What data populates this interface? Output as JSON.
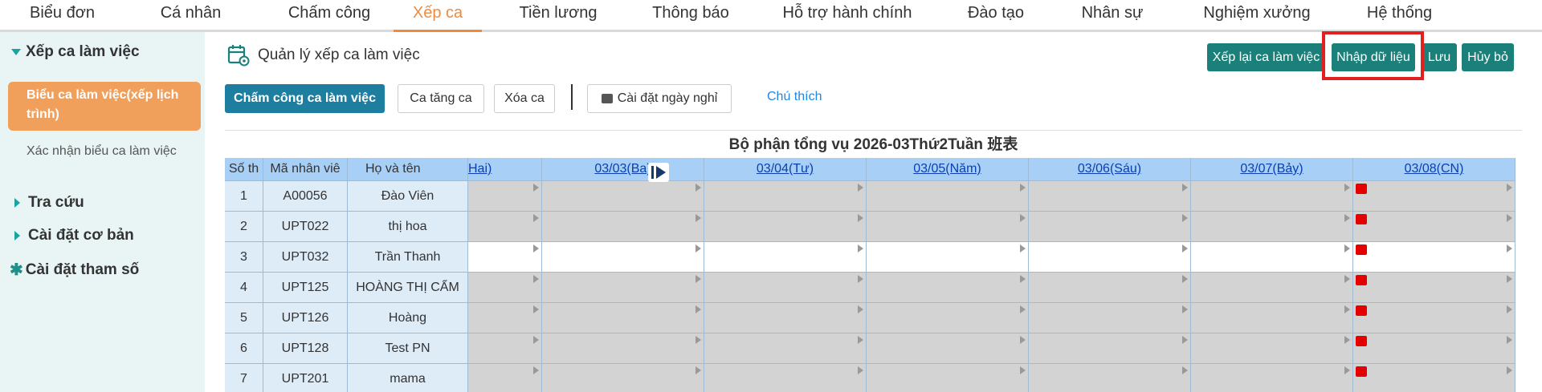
{
  "nav": {
    "tabs": [
      {
        "label": "Biểu đơn"
      },
      {
        "label": "Cá nhân"
      },
      {
        "label": "Chấm công"
      },
      {
        "label": "Xếp ca"
      },
      {
        "label": "Tiền lương"
      },
      {
        "label": "Thông báo"
      },
      {
        "label": "Hỗ trợ hành chính"
      },
      {
        "label": "Đào tạo"
      },
      {
        "label": "Nhân sự"
      },
      {
        "label": "Nghiệm xưởng"
      },
      {
        "label": "Hệ thống"
      }
    ],
    "active_index": 3
  },
  "sidebar": {
    "section_title": "Xếp ca làm việc",
    "active_item": "Biểu ca làm việc(xếp lịch trình)",
    "sub_item": "Xác nhận biểu ca làm việc",
    "items": [
      "Tra cứu",
      "Cài đặt cơ bản"
    ],
    "params_label": "Cài đặt tham số"
  },
  "page": {
    "title": "Quản lý xếp ca làm việc",
    "icon": "calendar-settings-icon"
  },
  "toolbar_right": {
    "reschedule": "Xếp lại ca làm việc",
    "import": "Nhập dữ liệu",
    "save": "Lưu",
    "cancel": "Hủy bỏ"
  },
  "toolbar_left": {
    "attendance": "Chấm công ca làm việc",
    "overtime": "Ca tăng ca",
    "delete": "Xóa ca",
    "holiday": "Cài đặt ngày nghỉ",
    "legend_link": "Chú thích"
  },
  "table": {
    "title": "Bộ phận tổng vụ 2026-03Thứ2Tuần  班表",
    "headers": {
      "no": "Số th",
      "code": "Mã nhân viê",
      "name": "Họ và tên",
      "dates": [
        "Hai)",
        "03/03(Ba)",
        "03/04(Tư)",
        "03/05(Năm)",
        "03/06(Sáu)",
        "03/07(Bảy)",
        "03/08(CN)"
      ]
    },
    "rows": [
      {
        "no": "1",
        "code": "A00056",
        "name": "Đào Viên",
        "white": false
      },
      {
        "no": "2",
        "code": "UPT022",
        "name": "thị hoa",
        "white": false
      },
      {
        "no": "3",
        "code": "UPT032",
        "name": "Trần Thanh",
        "white": true
      },
      {
        "no": "4",
        "code": "UPT125",
        "name": "HOÀNG THỊ CẨM",
        "white": false
      },
      {
        "no": "5",
        "code": "UPT126",
        "name": "Hoàng",
        "white": false
      },
      {
        "no": "6",
        "code": "UPT128",
        "name": "Test PN",
        "white": false
      },
      {
        "no": "7",
        "code": "UPT201",
        "name": "mama",
        "white": false
      }
    ]
  },
  "colors": {
    "accent_orange": "#f08a3c",
    "teal": "#1b8079",
    "primary_blue": "#1d7ea0",
    "header_blue": "#a8cff5",
    "highlight_red": "#e32020"
  }
}
